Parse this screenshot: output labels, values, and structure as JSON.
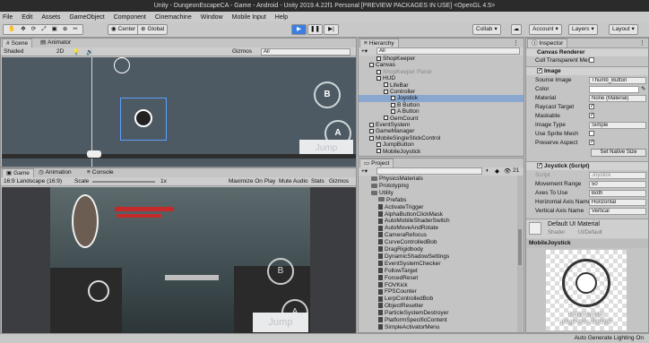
{
  "window": {
    "title": "Unity - DungeonEscapeCA - Game - Android - Unity 2019.4.22f1 Personal [PREVIEW PACKAGES IN USE] <OpenGL 4.5>"
  },
  "menu": [
    "File",
    "Edit",
    "Assets",
    "GameObject",
    "Component",
    "Cinemachine",
    "Window",
    "Mobile Input",
    "Help"
  ],
  "toolbar": {
    "center": "Center",
    "global": "Global",
    "collab": "Collab",
    "account": "Account",
    "layers": "Layers",
    "layout": "Layout"
  },
  "scene": {
    "tabs": [
      "Scene",
      "Animator"
    ],
    "shading": "Shaded",
    "mode2d": "2D",
    "gizmos": "Gizmos",
    "search": "All",
    "jump": "Jump"
  },
  "game": {
    "tabs": [
      "Game",
      "Animation",
      "Console"
    ],
    "aspect": "16:9 Landscape (16:9)",
    "scale_label": "Scale",
    "scale_value": "1x",
    "maximize": "Maximize On Play",
    "mute": "Mute Audio",
    "stats": "Stats",
    "gizmos": "Gizmos",
    "jump": "Jump"
  },
  "hierarchy": {
    "title": "Hierarchy",
    "search": "All",
    "items": [
      {
        "label": "ShopKeeper",
        "indent": 2,
        "dim": false
      },
      {
        "label": "Canvas",
        "indent": 1,
        "dim": false
      },
      {
        "label": "ShopKeeper Panel",
        "indent": 2,
        "dim": true
      },
      {
        "label": "HUD",
        "indent": 2,
        "dim": false
      },
      {
        "label": "LifeBar",
        "indent": 3,
        "dim": false
      },
      {
        "label": "Controller",
        "indent": 3,
        "dim": false
      },
      {
        "label": "Joystick",
        "indent": 4,
        "dim": false
      },
      {
        "label": "B Button",
        "indent": 4,
        "dim": false
      },
      {
        "label": "A Button",
        "indent": 4,
        "dim": false
      },
      {
        "label": "GemCount",
        "indent": 3,
        "dim": false
      },
      {
        "label": "EventSystem",
        "indent": 1,
        "dim": false
      },
      {
        "label": "GameManager",
        "indent": 1,
        "dim": false
      },
      {
        "label": "MobileSingleStickControl",
        "indent": 1,
        "dim": false
      },
      {
        "label": "JumpButton",
        "indent": 2,
        "dim": false
      },
      {
        "label": "MobileJoystick",
        "indent": 2,
        "dim": false
      }
    ]
  },
  "project": {
    "title": "Project",
    "count": "21",
    "items": [
      {
        "label": "PhysicsMaterials",
        "type": "folder",
        "indent": 1
      },
      {
        "label": "Prototyping",
        "type": "folder",
        "indent": 1
      },
      {
        "label": "Utility",
        "type": "folder",
        "indent": 1
      },
      {
        "label": "Prefabs",
        "type": "folder",
        "indent": 2
      },
      {
        "label": "ActivateTrigger",
        "type": "file",
        "indent": 2
      },
      {
        "label": "AlphaButtonClickMask",
        "type": "file",
        "indent": 2
      },
      {
        "label": "AutoMobileShaderSwitch",
        "type": "file",
        "indent": 2
      },
      {
        "label": "AutoMoveAndRotate",
        "type": "file",
        "indent": 2
      },
      {
        "label": "CameraRefocus",
        "type": "file",
        "indent": 2
      },
      {
        "label": "CurveControlledBob",
        "type": "file",
        "indent": 2
      },
      {
        "label": "DragRigidbody",
        "type": "file",
        "indent": 2
      },
      {
        "label": "DynamicShadowSettings",
        "type": "file",
        "indent": 2
      },
      {
        "label": "EventSystemChecker",
        "type": "file",
        "indent": 2
      },
      {
        "label": "FollowTarget",
        "type": "file",
        "indent": 2
      },
      {
        "label": "ForcedReset",
        "type": "file",
        "indent": 2
      },
      {
        "label": "FOVKick",
        "type": "file",
        "indent": 2
      },
      {
        "label": "FPSCounter",
        "type": "file",
        "indent": 2
      },
      {
        "label": "LerpControlledBob",
        "type": "file",
        "indent": 2
      },
      {
        "label": "ObjectResetter",
        "type": "file",
        "indent": 2
      },
      {
        "label": "ParticleSystemDestroyer",
        "type": "file",
        "indent": 2
      },
      {
        "label": "PlatformSpecificContent",
        "type": "file",
        "indent": 2
      },
      {
        "label": "SimpleActivatorMenu",
        "type": "file",
        "indent": 2
      }
    ]
  },
  "inspector": {
    "title": "Inspector",
    "canvas_renderer": "Canvas Renderer",
    "cull": "Cull Transparent Mes",
    "image": {
      "header": "Image",
      "source_label": "Source Image",
      "source_value": "Thumb_Button",
      "color_label": "Color",
      "material_label": "Material",
      "material_value": "None (Material)",
      "raycast_label": "Raycast Target",
      "maskable_label": "Maskable",
      "imagetype_label": "Image Type",
      "imagetype_value": "Simple",
      "usesprite_label": "Use Sprite Mesh",
      "preserve_label": "Preserve Aspect",
      "native_btn": "Set Native Size"
    },
    "joystick": {
      "header": "Joystick (Script)",
      "script_label": "Script",
      "script_value": "Joystick",
      "range_label": "Movement Range",
      "range_value": "50",
      "axes_label": "Axes To Use",
      "axes_value": "Both",
      "h_label": "Horizontal Axis Name",
      "h_value": "Horizontal",
      "v_label": "Vertical Axis Name",
      "v_value": "Vertical"
    },
    "material": {
      "name": "Default UI Material",
      "shader_label": "Shader",
      "shader_value": "UI/Default"
    },
    "preview": {
      "title": "MobileJoystick",
      "caption_line1": "MobileJoystick",
      "caption_line2": "Image Size: 256x256"
    }
  },
  "status": {
    "text": "Auto Generate Lighting On"
  },
  "colors": {
    "selection": "#8aa7cf",
    "play": "#3d7fe0",
    "scene_bg": "#4e5a63"
  }
}
